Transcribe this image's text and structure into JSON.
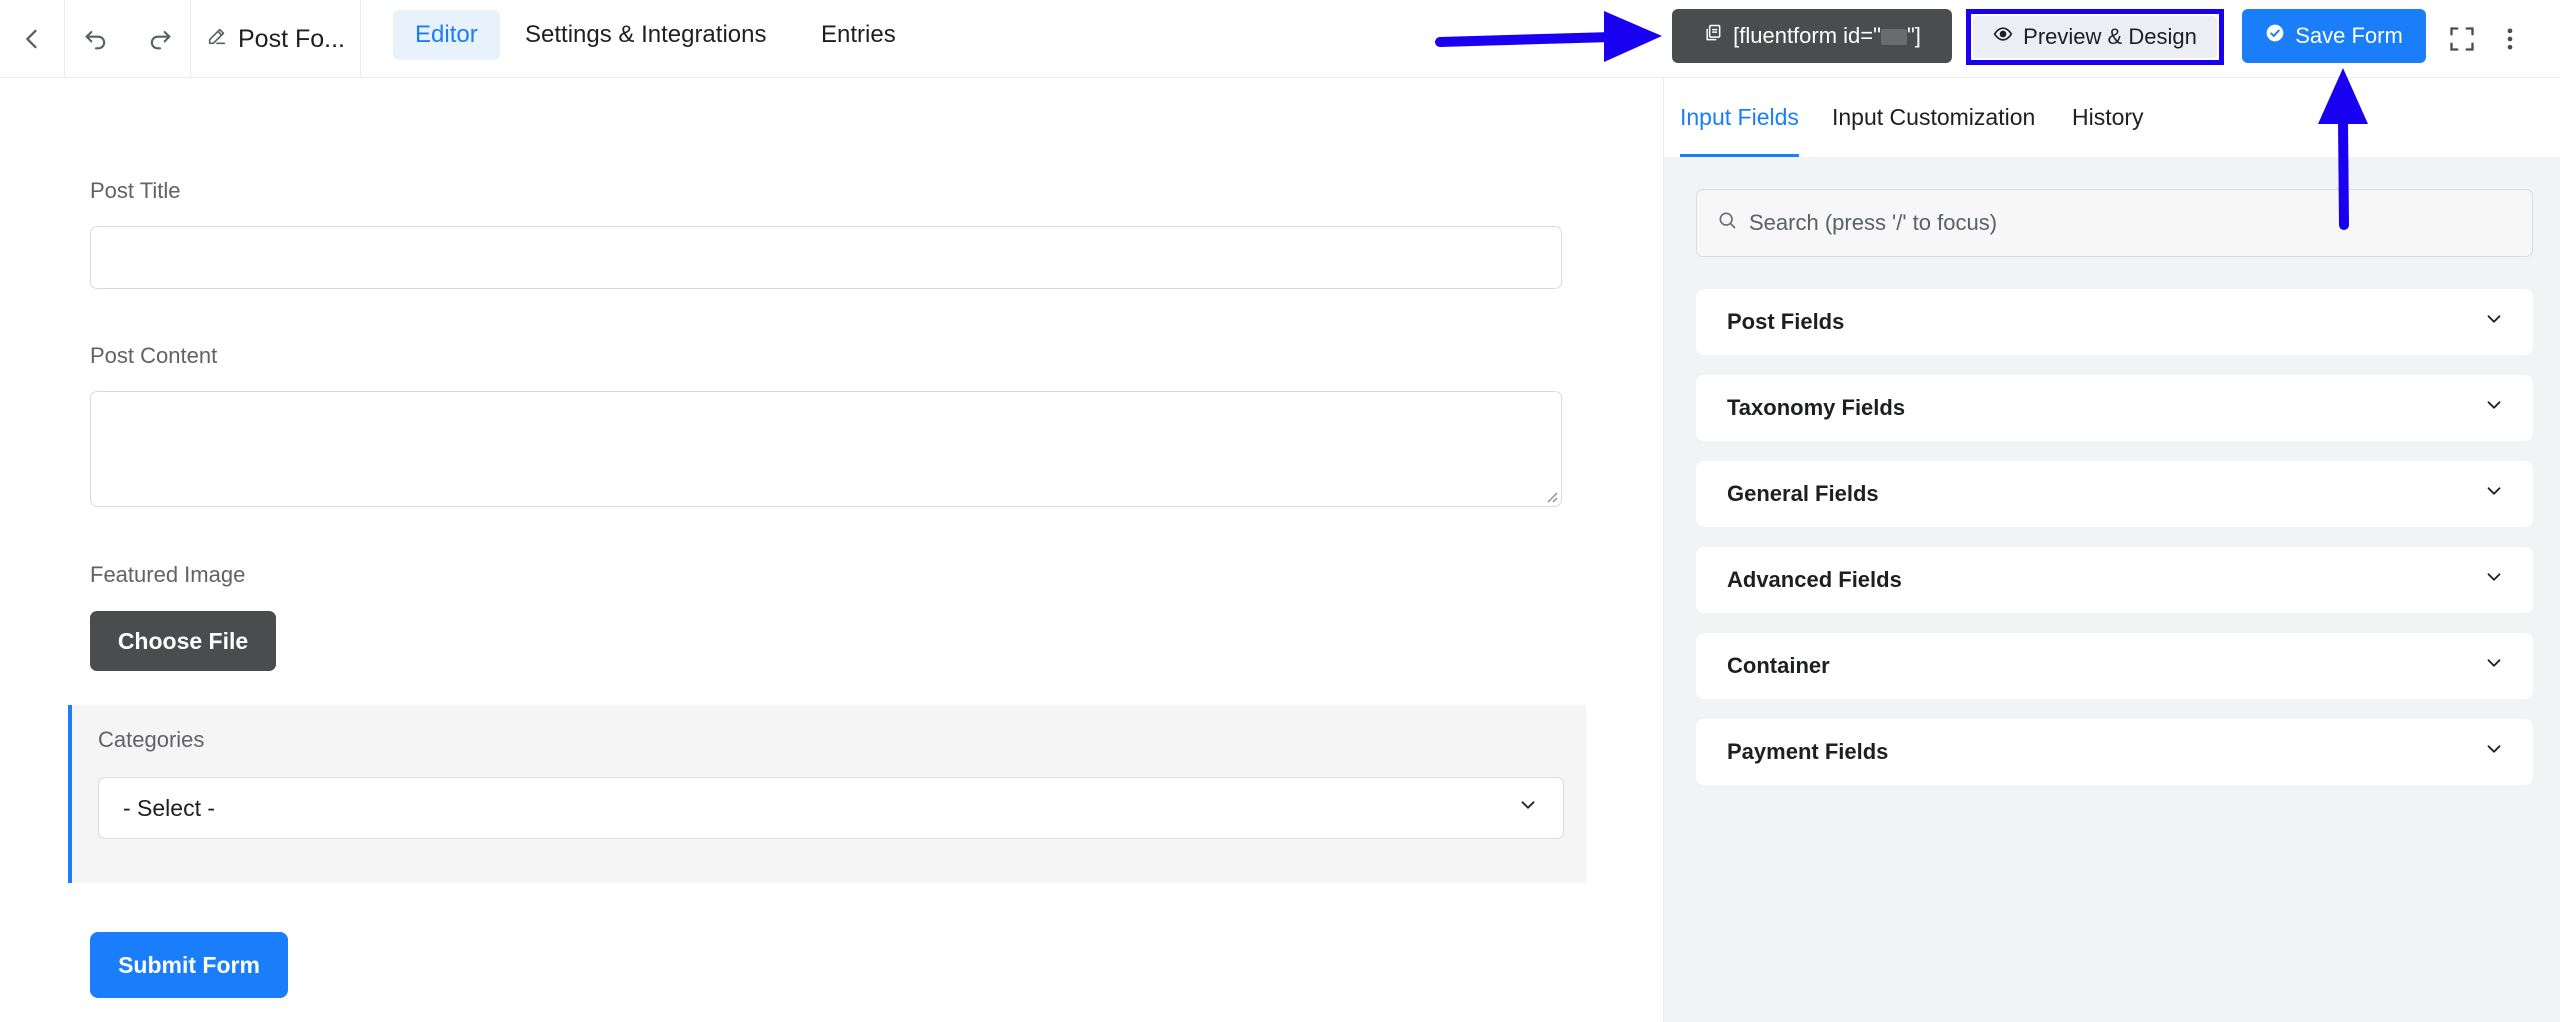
{
  "topbar": {
    "form_name": "Post Fo...",
    "tabs": [
      {
        "label": "Editor",
        "active": true
      },
      {
        "label": "Settings & Integrations",
        "active": false
      },
      {
        "label": "Entries",
        "active": false
      }
    ],
    "shortcode_prefix": "[fluentform id=\"",
    "shortcode_suffix": "\"]",
    "preview_label": "Preview & Design",
    "save_label": "Save Form"
  },
  "icons": {
    "back": "chevron-left-icon",
    "undo": "undo-icon",
    "redo": "redo-icon",
    "edit": "pencil-icon",
    "copy": "copy-icon",
    "preview": "eye-icon",
    "save": "check-circle-icon",
    "fullscreen": "fullscreen-icon",
    "more": "more-vertical-icon",
    "search": "search-icon",
    "chevron": "chevron-down-icon"
  },
  "editor": {
    "fields": {
      "post_title_label": "Post Title",
      "post_content_label": "Post Content",
      "featured_image_label": "Featured Image",
      "choose_file_label": "Choose File",
      "categories_label": "Categories",
      "categories_value": "- Select -"
    },
    "submit_label": "Submit Form"
  },
  "panel": {
    "tabs": [
      {
        "label": "Input Fields",
        "active": true
      },
      {
        "label": "Input Customization",
        "active": false
      },
      {
        "label": "History",
        "active": false
      }
    ],
    "search_placeholder": "Search (press '/' to focus)",
    "groups": [
      "Post Fields",
      "Taxonomy Fields",
      "General Fields",
      "Advanced Fields",
      "Container",
      "Payment Fields"
    ]
  },
  "colors": {
    "accent": "#1a7efb",
    "dark_button": "#4b4c4d",
    "annotation": "#1a00f0"
  }
}
